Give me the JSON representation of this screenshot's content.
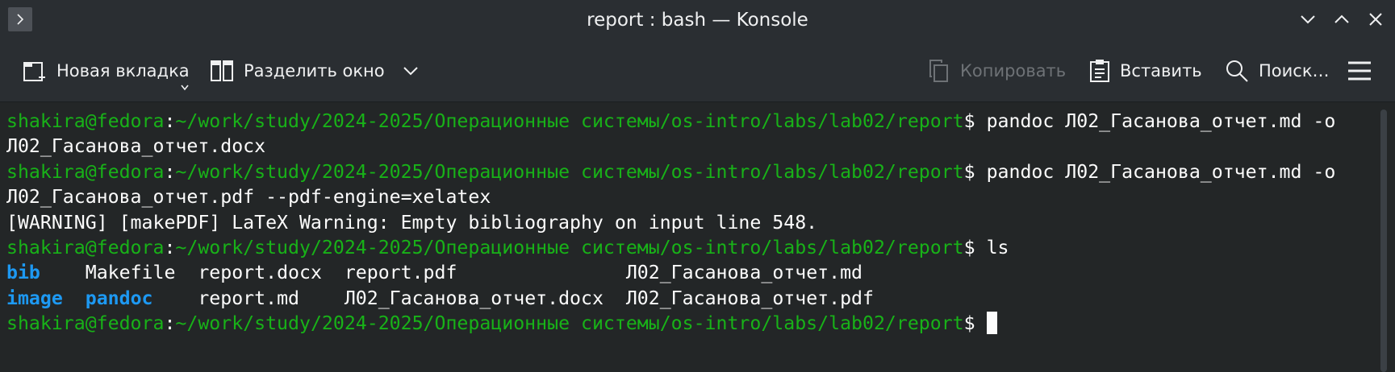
{
  "window": {
    "title": "report : bash — Konsole"
  },
  "toolbar": {
    "new_tab_label": "Новая вкладка",
    "split_view_label": "Разделить окно",
    "copy_label": "Копировать",
    "paste_label": "Вставить",
    "find_label": "Поиск…"
  },
  "terminal": {
    "line1": {
      "user": "shakira@fedora",
      "colon": ":",
      "path": "~/work/study/2024-2025/Операционные системы/os-intro/labs/lab02/report",
      "prompt": "$ ",
      "cmd": "pandoc Л02_Гасанова_отчет.md -o"
    },
    "line2": "Л02_Гасанова_отчет.docx",
    "line3": {
      "user": "shakira@fedora",
      "colon": ":",
      "path": "~/work/study/2024-2025/Операционные системы/os-intro/labs/lab02/report",
      "prompt": "$ ",
      "cmd": "pandoc Л02_Гасанова_отчет.md -o"
    },
    "line4": "Л02_Гасанова_отчет.pdf --pdf-engine=xelatex",
    "line5": "[WARNING] [makePDF] LaTeX Warning: Empty bibliography on input line 548.",
    "line6": {
      "user": "shakira@fedora",
      "colon": ":",
      "path": "~/work/study/2024-2025/Операционные системы/os-intro/labs/lab02/report",
      "prompt": "$ ",
      "cmd": "ls"
    },
    "ls_row1": {
      "c1": "bib",
      "c1_pad": "    ",
      "c2": "Makefile",
      "c2_pad": "  ",
      "c3": "report.docx",
      "c3_pad": "  ",
      "c4": "report.pdf",
      "c4_pad": "               ",
      "c5": "Л02_Гасанова_отчет.md"
    },
    "ls_row2": {
      "c1": "image",
      "c1_pad": "  ",
      "c2": "pandoc",
      "c2_pad": "    ",
      "c3": "report.md",
      "c3_pad": "    ",
      "c4": "Л02_Гасанова_отчет.docx",
      "c4_pad": "  ",
      "c5": "Л02_Гасанова_отчет.pdf"
    },
    "line9": {
      "user": "shakira@fedora",
      "colon": ":",
      "path": "~/work/study/2024-2025/Операционные системы/os-intro/labs/lab02/report",
      "prompt": "$ "
    }
  },
  "colors": {
    "prompt_green": "#18b218",
    "directory_blue": "#1d99f3",
    "terminal_bg": "#232627",
    "titlebar_bg": "#2a2e32"
  },
  "icons": {
    "app_menu": "chevron-right-icon",
    "minimize": "chevron-down-icon",
    "maximize": "chevron-up-icon",
    "close": "close-icon",
    "new_tab": "new-tab-icon",
    "split_view": "split-view-icon",
    "copy": "copy-icon",
    "paste": "paste-icon",
    "find": "search-icon",
    "menu": "hamburger-menu-icon"
  }
}
